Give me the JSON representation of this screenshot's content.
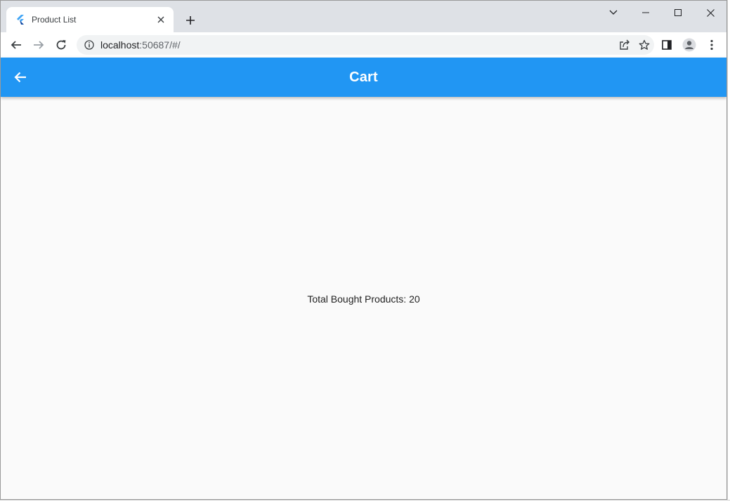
{
  "browser": {
    "tab": {
      "title": "Product List"
    },
    "address": {
      "host": "localhost",
      "path": ":50687/#/"
    }
  },
  "app": {
    "appbar": {
      "title": "Cart"
    },
    "body": {
      "total_text": "Total Bought Products: 20"
    }
  },
  "colors": {
    "appbar": "#2196f3",
    "background": "#fafafa"
  }
}
